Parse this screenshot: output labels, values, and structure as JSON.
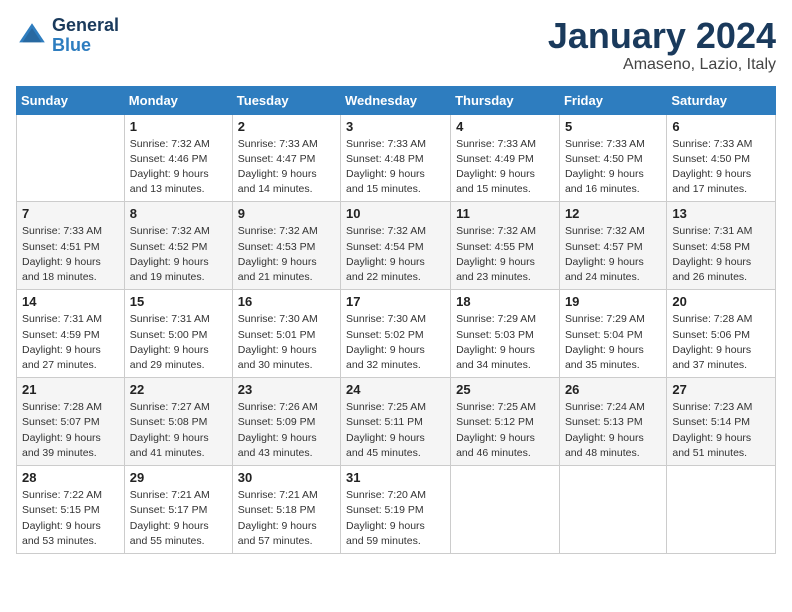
{
  "header": {
    "logo_general": "General",
    "logo_blue": "Blue",
    "month": "January 2024",
    "location": "Amaseno, Lazio, Italy"
  },
  "weekdays": [
    "Sunday",
    "Monday",
    "Tuesday",
    "Wednesday",
    "Thursday",
    "Friday",
    "Saturday"
  ],
  "weeks": [
    [
      {
        "num": "",
        "sunrise": "",
        "sunset": "",
        "daylight": ""
      },
      {
        "num": "1",
        "sunrise": "Sunrise: 7:32 AM",
        "sunset": "Sunset: 4:46 PM",
        "daylight": "Daylight: 9 hours and 13 minutes."
      },
      {
        "num": "2",
        "sunrise": "Sunrise: 7:33 AM",
        "sunset": "Sunset: 4:47 PM",
        "daylight": "Daylight: 9 hours and 14 minutes."
      },
      {
        "num": "3",
        "sunrise": "Sunrise: 7:33 AM",
        "sunset": "Sunset: 4:48 PM",
        "daylight": "Daylight: 9 hours and 15 minutes."
      },
      {
        "num": "4",
        "sunrise": "Sunrise: 7:33 AM",
        "sunset": "Sunset: 4:49 PM",
        "daylight": "Daylight: 9 hours and 15 minutes."
      },
      {
        "num": "5",
        "sunrise": "Sunrise: 7:33 AM",
        "sunset": "Sunset: 4:50 PM",
        "daylight": "Daylight: 9 hours and 16 minutes."
      },
      {
        "num": "6",
        "sunrise": "Sunrise: 7:33 AM",
        "sunset": "Sunset: 4:50 PM",
        "daylight": "Daylight: 9 hours and 17 minutes."
      }
    ],
    [
      {
        "num": "7",
        "sunrise": "Sunrise: 7:33 AM",
        "sunset": "Sunset: 4:51 PM",
        "daylight": "Daylight: 9 hours and 18 minutes."
      },
      {
        "num": "8",
        "sunrise": "Sunrise: 7:32 AM",
        "sunset": "Sunset: 4:52 PM",
        "daylight": "Daylight: 9 hours and 19 minutes."
      },
      {
        "num": "9",
        "sunrise": "Sunrise: 7:32 AM",
        "sunset": "Sunset: 4:53 PM",
        "daylight": "Daylight: 9 hours and 21 minutes."
      },
      {
        "num": "10",
        "sunrise": "Sunrise: 7:32 AM",
        "sunset": "Sunset: 4:54 PM",
        "daylight": "Daylight: 9 hours and 22 minutes."
      },
      {
        "num": "11",
        "sunrise": "Sunrise: 7:32 AM",
        "sunset": "Sunset: 4:55 PM",
        "daylight": "Daylight: 9 hours and 23 minutes."
      },
      {
        "num": "12",
        "sunrise": "Sunrise: 7:32 AM",
        "sunset": "Sunset: 4:57 PM",
        "daylight": "Daylight: 9 hours and 24 minutes."
      },
      {
        "num": "13",
        "sunrise": "Sunrise: 7:31 AM",
        "sunset": "Sunset: 4:58 PM",
        "daylight": "Daylight: 9 hours and 26 minutes."
      }
    ],
    [
      {
        "num": "14",
        "sunrise": "Sunrise: 7:31 AM",
        "sunset": "Sunset: 4:59 PM",
        "daylight": "Daylight: 9 hours and 27 minutes."
      },
      {
        "num": "15",
        "sunrise": "Sunrise: 7:31 AM",
        "sunset": "Sunset: 5:00 PM",
        "daylight": "Daylight: 9 hours and 29 minutes."
      },
      {
        "num": "16",
        "sunrise": "Sunrise: 7:30 AM",
        "sunset": "Sunset: 5:01 PM",
        "daylight": "Daylight: 9 hours and 30 minutes."
      },
      {
        "num": "17",
        "sunrise": "Sunrise: 7:30 AM",
        "sunset": "Sunset: 5:02 PM",
        "daylight": "Daylight: 9 hours and 32 minutes."
      },
      {
        "num": "18",
        "sunrise": "Sunrise: 7:29 AM",
        "sunset": "Sunset: 5:03 PM",
        "daylight": "Daylight: 9 hours and 34 minutes."
      },
      {
        "num": "19",
        "sunrise": "Sunrise: 7:29 AM",
        "sunset": "Sunset: 5:04 PM",
        "daylight": "Daylight: 9 hours and 35 minutes."
      },
      {
        "num": "20",
        "sunrise": "Sunrise: 7:28 AM",
        "sunset": "Sunset: 5:06 PM",
        "daylight": "Daylight: 9 hours and 37 minutes."
      }
    ],
    [
      {
        "num": "21",
        "sunrise": "Sunrise: 7:28 AM",
        "sunset": "Sunset: 5:07 PM",
        "daylight": "Daylight: 9 hours and 39 minutes."
      },
      {
        "num": "22",
        "sunrise": "Sunrise: 7:27 AM",
        "sunset": "Sunset: 5:08 PM",
        "daylight": "Daylight: 9 hours and 41 minutes."
      },
      {
        "num": "23",
        "sunrise": "Sunrise: 7:26 AM",
        "sunset": "Sunset: 5:09 PM",
        "daylight": "Daylight: 9 hours and 43 minutes."
      },
      {
        "num": "24",
        "sunrise": "Sunrise: 7:25 AM",
        "sunset": "Sunset: 5:11 PM",
        "daylight": "Daylight: 9 hours and 45 minutes."
      },
      {
        "num": "25",
        "sunrise": "Sunrise: 7:25 AM",
        "sunset": "Sunset: 5:12 PM",
        "daylight": "Daylight: 9 hours and 46 minutes."
      },
      {
        "num": "26",
        "sunrise": "Sunrise: 7:24 AM",
        "sunset": "Sunset: 5:13 PM",
        "daylight": "Daylight: 9 hours and 48 minutes."
      },
      {
        "num": "27",
        "sunrise": "Sunrise: 7:23 AM",
        "sunset": "Sunset: 5:14 PM",
        "daylight": "Daylight: 9 hours and 51 minutes."
      }
    ],
    [
      {
        "num": "28",
        "sunrise": "Sunrise: 7:22 AM",
        "sunset": "Sunset: 5:15 PM",
        "daylight": "Daylight: 9 hours and 53 minutes."
      },
      {
        "num": "29",
        "sunrise": "Sunrise: 7:21 AM",
        "sunset": "Sunset: 5:17 PM",
        "daylight": "Daylight: 9 hours and 55 minutes."
      },
      {
        "num": "30",
        "sunrise": "Sunrise: 7:21 AM",
        "sunset": "Sunset: 5:18 PM",
        "daylight": "Daylight: 9 hours and 57 minutes."
      },
      {
        "num": "31",
        "sunrise": "Sunrise: 7:20 AM",
        "sunset": "Sunset: 5:19 PM",
        "daylight": "Daylight: 9 hours and 59 minutes."
      },
      {
        "num": "",
        "sunrise": "",
        "sunset": "",
        "daylight": ""
      },
      {
        "num": "",
        "sunrise": "",
        "sunset": "",
        "daylight": ""
      },
      {
        "num": "",
        "sunrise": "",
        "sunset": "",
        "daylight": ""
      }
    ]
  ]
}
